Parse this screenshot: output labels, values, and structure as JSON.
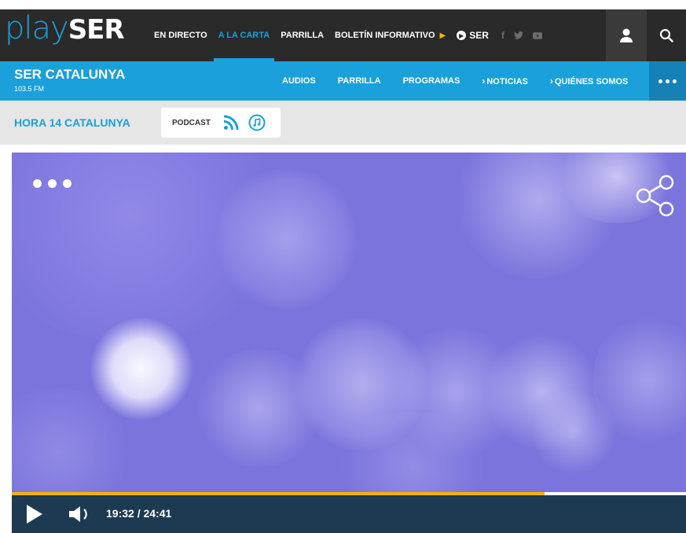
{
  "logo": {
    "play": "play",
    "ser": "SER"
  },
  "topnav": {
    "items": [
      "EN DIRECTO",
      "A LA CARTA",
      "PARRILLA",
      "BOLETÍN INFORMATIVO"
    ],
    "active_index": 1,
    "ser_label": "SER",
    "social": [
      "f",
      "t",
      "yt"
    ]
  },
  "station": {
    "name": "SER CATALUNYA",
    "frequency": "103.5 FM",
    "nav": [
      "AUDIOS",
      "PARRILLA",
      "PROGRAMAS",
      "NOTICIAS",
      "QUIÉNES SOMOS"
    ]
  },
  "program": {
    "title": "HORA 14 CATALUNYA",
    "podcast_label": "PODCAST"
  },
  "player": {
    "time": "19:32 / 24:41",
    "progress_fraction": 0.79
  },
  "colors": {
    "accent": "#1aa0da",
    "topbar_bg": "#2a2a2a",
    "progress": "#f4b400",
    "controls_bg": "#1c3a52"
  }
}
